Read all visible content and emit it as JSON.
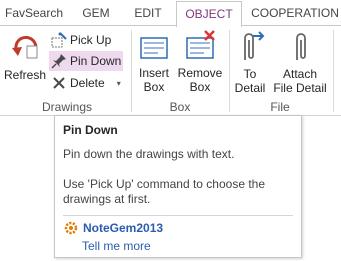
{
  "tabs": [
    {
      "label": "FavSearch",
      "active": false
    },
    {
      "label": "GEM",
      "active": false
    },
    {
      "label": "EDIT",
      "active": false
    },
    {
      "label": "OBJECT",
      "active": true
    },
    {
      "label": "COOPERATION",
      "active": false
    }
  ],
  "ribbon": {
    "drawings": {
      "label": "Drawings",
      "refresh": {
        "label": "Refresh",
        "icon": "refresh-icon"
      },
      "pick_up": {
        "label": "Pick Up",
        "icon": "pick-up-icon"
      },
      "pin_down": {
        "label": "Pin Down",
        "icon": "pin-icon"
      },
      "delete": {
        "label": "Delete",
        "icon": "delete-x-icon"
      }
    },
    "box": {
      "label": "Box",
      "insert_box": {
        "line1": "Insert",
        "line2": "Box",
        "icon": "insert-box-icon"
      },
      "remove_box": {
        "line1": "Remove",
        "line2": "Box",
        "icon": "remove-box-icon"
      }
    },
    "file": {
      "label": "File",
      "to_detail": {
        "line1": "To",
        "line2": "Detail",
        "icon": "paperclip-arrow-icon"
      },
      "attach_file_detail": {
        "line1": "Attach",
        "line2": "File Detail",
        "icon": "paperclip-icon"
      }
    }
  },
  "tooltip": {
    "title": "Pin Down",
    "line1": "Pin down the drawings with text.",
    "line2": "Use 'Pick Up' command to choose the drawings at first.",
    "brand": "NoteGem2013",
    "link": "Tell me more"
  },
  "colors": {
    "active_tab_text": "#80397b",
    "highlight": "#efd9ef",
    "link": "#2a5db0",
    "refresh_red": "#c0392b",
    "icon_blue": "#2f6db5"
  }
}
